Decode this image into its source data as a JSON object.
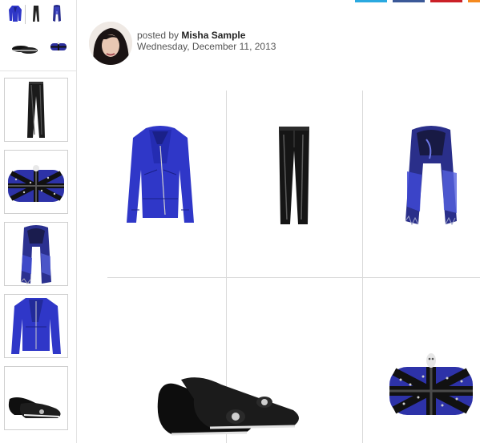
{
  "post": {
    "posted_by_prefix": "posted by",
    "author": "Misha Sample",
    "date": "Wednesday, December 11, 2013"
  },
  "colors": {
    "share_twitter": "#2aa9e0",
    "share_facebook": "#3b5998",
    "share_pinterest": "#cb2027",
    "share_other": "#f58a1f",
    "cobalt": "#2f37c8"
  },
  "sidebar_items": [
    "leather-pants",
    "union-jack-clutch",
    "blue-scarf",
    "blue-biker-jacket",
    "velvet-slippers"
  ],
  "grid_items": [
    "blue-biker-jacket",
    "leather-pants",
    "blue-scarf",
    "velvet-slippers",
    "union-jack-clutch"
  ]
}
